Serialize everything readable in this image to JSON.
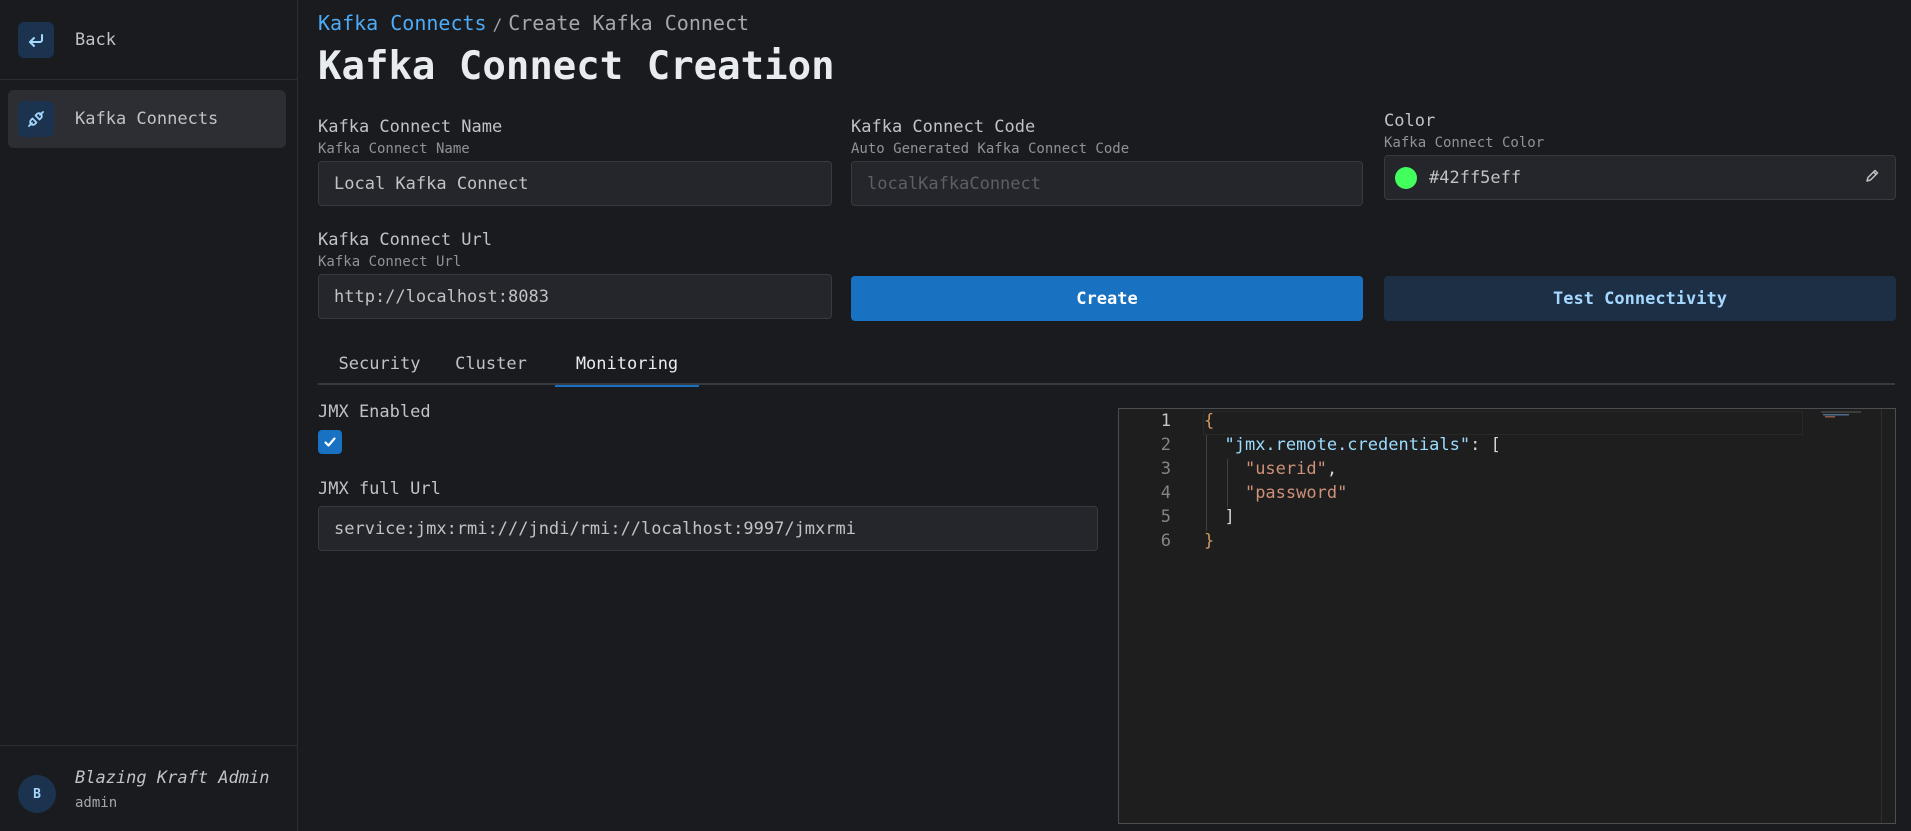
{
  "sidebar": {
    "back_label": "Back",
    "items": [
      {
        "label": "Kafka Connects",
        "icon": "plug-icon"
      }
    ],
    "user": {
      "avatar_letter": "B",
      "name": "Blazing Kraft Admin",
      "role": "admin"
    }
  },
  "breadcrumb": {
    "parent": "Kafka Connects",
    "separator": "/",
    "current": "Create Kafka Connect"
  },
  "page_title": "Kafka Connect Creation",
  "form": {
    "name": {
      "label": "Kafka Connect Name",
      "description": "Kafka Connect Name",
      "value": "Local Kafka Connect"
    },
    "code": {
      "label": "Kafka Connect Code",
      "description": "Auto Generated Kafka Connect Code",
      "value": "localKafkaConnect"
    },
    "color": {
      "label": "Color",
      "description": "Kafka Connect Color",
      "value": "#42ff5eff",
      "swatch": "#42ff5e"
    },
    "url": {
      "label": "Kafka Connect Url",
      "description": "Kafka Connect Url",
      "value": "http://localhost:8083"
    }
  },
  "buttons": {
    "create": "Create",
    "test": "Test Connectivity"
  },
  "tabs": [
    {
      "label": "Security",
      "active": false
    },
    {
      "label": "Cluster",
      "active": false
    },
    {
      "label": "Monitoring",
      "active": true
    }
  ],
  "monitoring": {
    "jmx_enabled_label": "JMX Enabled",
    "jmx_enabled": true,
    "jmx_url_label": "JMX full Url",
    "jmx_url_value": "service:jmx:rmi:///jndi/rmi://localhost:9997/jmxrmi"
  },
  "editor": {
    "line_numbers": [
      "1",
      "2",
      "3",
      "4",
      "5",
      "6"
    ],
    "lines": [
      [
        {
          "t": "{",
          "c": "brace"
        }
      ],
      [
        {
          "t": "  ",
          "c": "punc"
        },
        {
          "t": "\"jmx.remote.credentials\"",
          "c": "key"
        },
        {
          "t": ": [",
          "c": "punc"
        }
      ],
      [
        {
          "t": "    ",
          "c": "punc"
        },
        {
          "t": "\"userid\"",
          "c": "str"
        },
        {
          "t": ",",
          "c": "punc"
        }
      ],
      [
        {
          "t": "    ",
          "c": "punc"
        },
        {
          "t": "\"password\"",
          "c": "str"
        }
      ],
      [
        {
          "t": "  ",
          "c": "punc"
        },
        {
          "t": "]",
          "c": "punc"
        }
      ],
      [
        {
          "t": "}",
          "c": "brace"
        }
      ]
    ]
  },
  "colors": {
    "accent": "#1971c2",
    "link": "#4dabf7",
    "background": "#1a1b1e"
  }
}
